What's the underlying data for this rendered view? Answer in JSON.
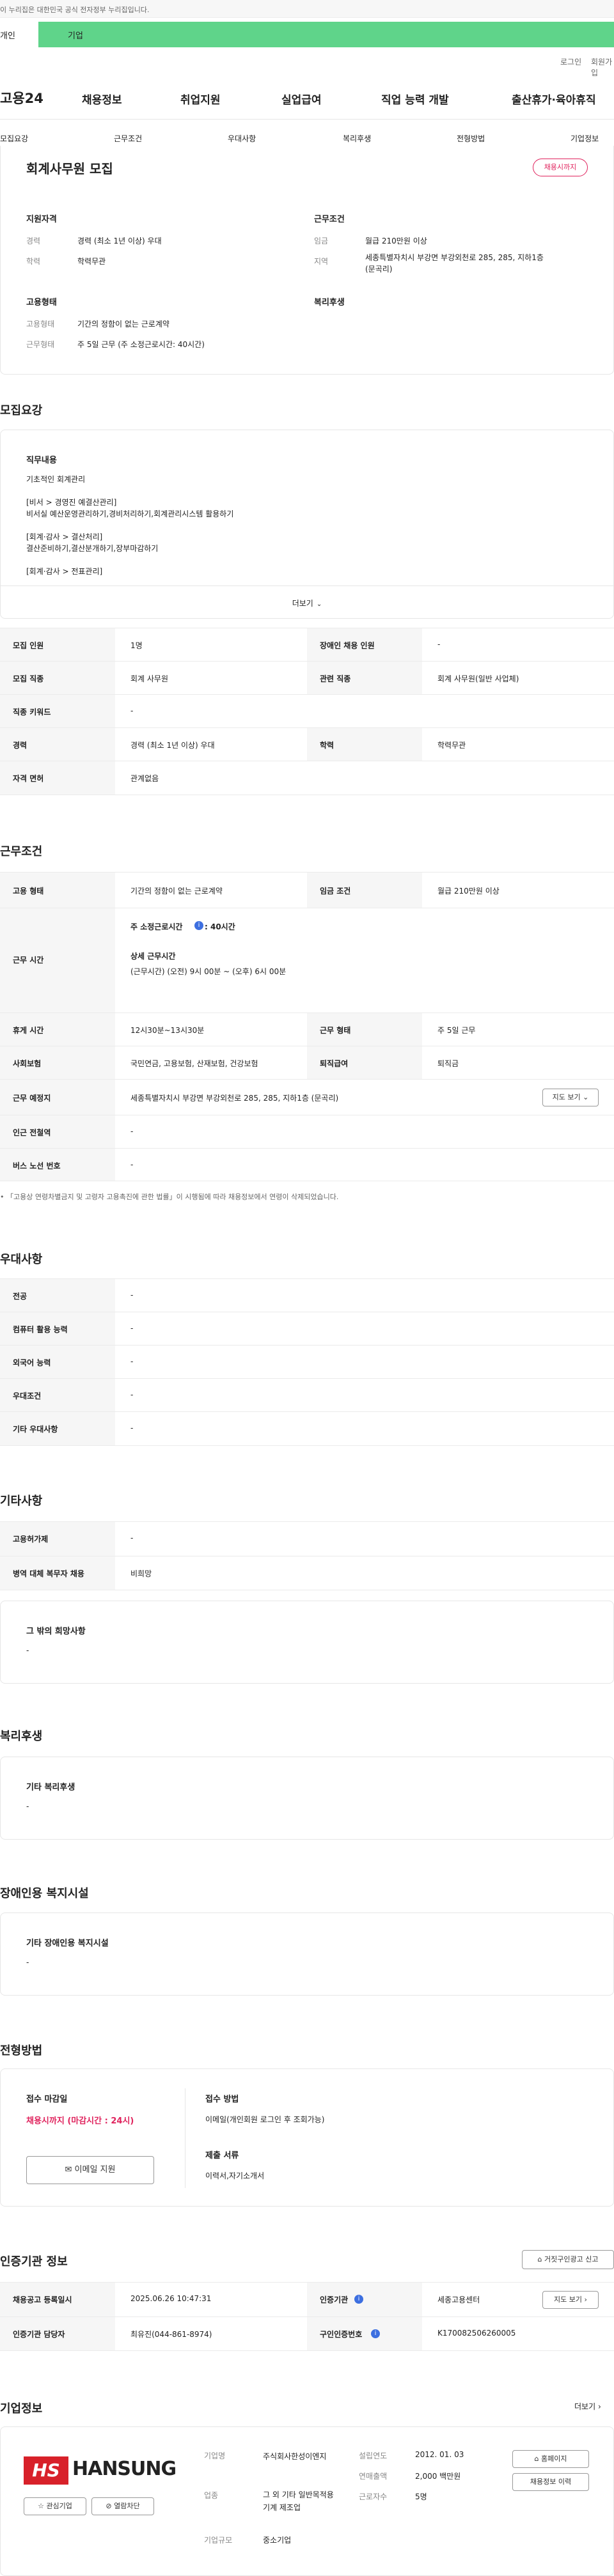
{
  "gov_banner": "이 누리집은 대한민국 공식 전자정부 누리집입니다.",
  "tabs": [
    "개인",
    "기업"
  ],
  "util": [
    "로그인",
    "회원가입"
  ],
  "logo": "고용24",
  "nav": [
    "채용정보",
    "취업지원",
    "실업급여",
    "직업 능력 개발",
    "출산휴가·육아휴직"
  ],
  "subnav": [
    "모집요강",
    "근무조건",
    "우대사항",
    "복리후생",
    "전형방법",
    "기업정보"
  ],
  "job": {
    "title": "회계사무원 모집",
    "badge": "채용시까지",
    "h_qual": "지원자격",
    "h_cond": "근무조건",
    "h_emp": "고용형태",
    "h_welfare": "복리후생",
    "career_l": "경력",
    "career_v": "경력 (최소 1년 이상) 우대",
    "edu_l": "학력",
    "edu_v": "학력무관",
    "wage_l": "임금",
    "wage_v": "월급 210만원 이상",
    "region_l": "지역",
    "region_v1": "세종특별자치시 부강면 부강외천로 285, 285, 지하1층",
    "region_v2": "(문곡리)",
    "emptype_l": "고용형태",
    "emptype_v": "기간의 정함이 없는 근로계약",
    "workform_l": "근무형태",
    "workform_v": "주 5일 근무 (주 소정근로시간: 40시간)"
  },
  "s_recruit": {
    "title": "모집요강",
    "duty_label": "직무내용",
    "lines": [
      "기초적인 회계관리",
      "",
      "[비서 > 경영진 예결산관리]",
      "비서실 예산운영관리하기,경비처리하기,회계관리시스템 활용하기",
      "",
      "[회계·감사 > 결산처리]",
      "결산준비하기,결산분개하기,장부마감하기",
      "",
      "[회계·감사 > 전표관리]"
    ],
    "more": "더보기",
    "t": [
      [
        "모집 인원",
        "1명",
        "장애인 채용 인원",
        "-"
      ],
      [
        "모집 직종",
        "회계 사무원",
        "관련 직종",
        "회계 사무원(일반 사업체)"
      ],
      [
        "직종 키워드",
        "-"
      ],
      [
        "경력",
        "경력 (최소 1년 이상) 우대",
        "학력",
        "학력무관"
      ],
      [
        "자격 면허",
        "관계없음"
      ]
    ]
  },
  "s_cond": {
    "title": "근무조건",
    "emptype": [
      "고용 형태",
      "기간의 정함이 없는 근로계약",
      "임금 조건",
      "월급 210만원 이상"
    ],
    "worktime_l": "근무 시간",
    "worktime_week": "주 소정근로시간",
    "worktime_week_v": ": 40시간",
    "worktime_detail_t": "상세 근무시간",
    "worktime_detail_v": "(근무시간) (오전) 9시 00분 ~ (오후) 6시 00분",
    "break": [
      "휴게 시간",
      "12시30분~13시30분",
      "근무 형태",
      "주 5일 근무"
    ],
    "insure": [
      "사회보험",
      "국민연금, 고용보험, 산재보험, 건강보험",
      "퇴직급여",
      "퇴직금"
    ],
    "place": [
      "근무 예정지",
      "세종특별자치시 부강면 부강외천로 285, 285, 지하1층 (문곡리)"
    ],
    "map_btn": "지도 보기",
    "subway": [
      "인근 전철역",
      "-"
    ],
    "bus": [
      "버스 노선 번호",
      "-"
    ],
    "notice": "「고용상 연령차별금지 및 고령자 고용촉진에 관한 법률」이 시행됨에 따라 채용정보에서 연령이 삭제되었습니다."
  },
  "s_pref": {
    "title": "우대사항",
    "rows": [
      [
        "전공",
        "-"
      ],
      [
        "컴퓨터 활용 능력",
        "-"
      ],
      [
        "외국어 능력",
        "-"
      ],
      [
        "우대조건",
        "-"
      ],
      [
        "기타 우대사항",
        "-"
      ]
    ]
  },
  "s_etc": {
    "title": "기타사항",
    "rows": [
      [
        "고용허가제",
        "-"
      ],
      [
        "병역 대체 복무자 채용",
        "비희망"
      ]
    ],
    "box_t": "그 밖의 희망사항",
    "box_v": "-"
  },
  "s_welfare": {
    "title": "복리후생",
    "box_t": "기타 복리후생",
    "box_v": "-"
  },
  "s_disab": {
    "title": "장애인용 복지시설",
    "box_t": "기타 장애인용 복지시설",
    "box_v": "-"
  },
  "s_select": {
    "title": "전형방법",
    "deadline_t": "접수 마감일",
    "deadline_v": "채용시까지 (마감시간 : 24시)",
    "method_t": "접수 방법",
    "method_v": "이메일(개인회원 로그인 후 조회가능)",
    "apply_btn": "이메일 지원",
    "docs_t": "제출 서류",
    "docs_v": "이력서,자기소개서"
  },
  "s_cert": {
    "title": "인증기관 정보",
    "report_btn": "거짓구인광고 신고",
    "rows": [
      [
        "채용공고 등록일시",
        "2025.06.26 10:47:31",
        "인증기관",
        "세종고용센터"
      ],
      [
        "인증기관 담당자",
        "최유진(044-861-8974)",
        "구인인증번호",
        "K170082506260005"
      ]
    ],
    "map_btn": "지도 보기"
  },
  "s_company": {
    "title": "기업정보",
    "more": "더보기",
    "logo": "HANSUNG",
    "fav": "관심기업",
    "block": "열람차단",
    "kv": [
      [
        "기업명",
        "주식회사한성이엔지"
      ],
      [
        "업종",
        "그 외 기타 일반목적용 기계 제조업"
      ],
      [
        "기업규모",
        "중소기업"
      ]
    ],
    "kv2": [
      [
        "설립연도",
        "2012. 01. 03"
      ],
      [
        "연매출액",
        "2,000 백만원"
      ],
      [
        "근로자수",
        "5명"
      ]
    ],
    "hp_btn": "홈페이지",
    "jobs_btn": "채용정보 이력"
  },
  "colors": {
    "accent_green": "#5fd48a",
    "badge_red": "#e0245e",
    "link_blue": "#3d6fe0"
  }
}
